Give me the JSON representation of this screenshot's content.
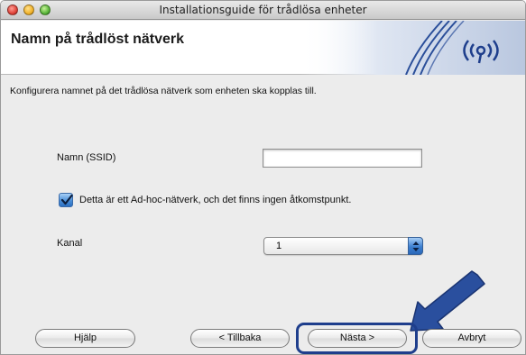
{
  "window": {
    "title": "Installationsguide för trådlösa enheter"
  },
  "header": {
    "title": "Namn på trådlöst nätverk"
  },
  "main": {
    "description": "Konfigurera namnet på det trådlösa nätverk som enheten ska kopplas till.",
    "ssid": {
      "label": "Namn (SSID)",
      "value": ""
    },
    "adhoc": {
      "checked": true,
      "label": "Detta är ett Ad-hoc-nätverk, och det finns ingen åtkomstpunkt."
    },
    "channel": {
      "label": "Kanal",
      "selected": "1"
    }
  },
  "buttons": {
    "help": "Hjälp",
    "back": "< Tillbaka",
    "next": "Nästa >",
    "cancel": "Avbryt"
  },
  "colors": {
    "accent": "#2a6fc1",
    "arrow": "#2a4f9e",
    "focus_ring": "#1e3e8c"
  },
  "icons": [
    "wireless-signal-icon",
    "check-icon",
    "up-down-arrows-icon",
    "pointer-arrow-icon"
  ]
}
